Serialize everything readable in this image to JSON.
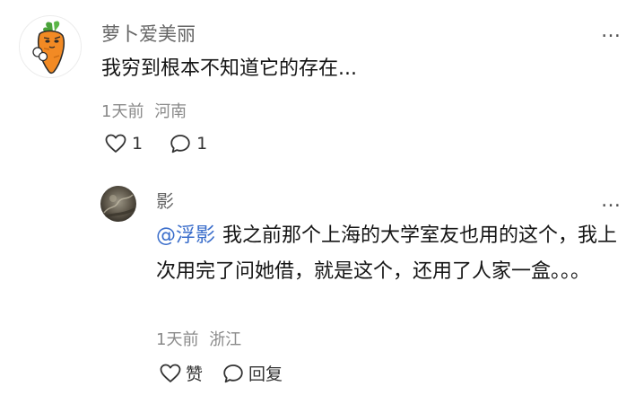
{
  "comments": {
    "main": {
      "username": "萝卜爱美丽",
      "more": "…",
      "text": "我穷到根本不知道它的存在...",
      "time": "1天前",
      "location": "河南",
      "like_count": "1",
      "reply_count": "1",
      "avatar_icon": "carrot-avatar-icon"
    },
    "reply": {
      "username": "影",
      "more": "…",
      "mention": "@浮影",
      "text": "我之前那个上海的大学室友也用的这个，我上次用完了问她借，就是这个，还用了人家一盒。。。",
      "time": "1天前",
      "location": "浙江",
      "like_label": "赞",
      "reply_label": "回复",
      "avatar_icon": "photo-avatar-icon"
    }
  },
  "colors": {
    "username": "#666666",
    "meta": "#8a8a8a",
    "mention": "#3b6ecb",
    "text": "#151515"
  }
}
